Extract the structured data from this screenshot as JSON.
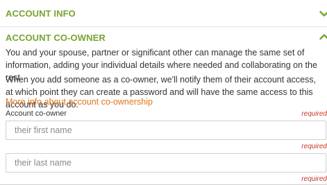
{
  "sections": {
    "account_info": {
      "title": "ACCOUNT INFO",
      "state_icon": "chevron-down-icon"
    },
    "account_coowner": {
      "title": "ACCOUNT CO-OWNER",
      "state_icon": "chevron-up-icon"
    }
  },
  "coowner": {
    "paragraph1": "You and your spouse, partner or significant other can manage the same set of information, adding your individual details where needed and collaborating on the rest.",
    "paragraph2": "When you add someone as a co-owner, we'll notify them of their account access, at which point they can create a password and will have the same access to this account as you do.",
    "more_info_link": "More info about account co-ownership",
    "field_label": "Account co-owner",
    "required_text": "required",
    "first_name_placeholder": "their first name",
    "last_name_placeholder": "their last name"
  },
  "colors": {
    "accent_green": "#78a332",
    "link_orange": "#e0751a",
    "required_red": "#c0392b"
  }
}
